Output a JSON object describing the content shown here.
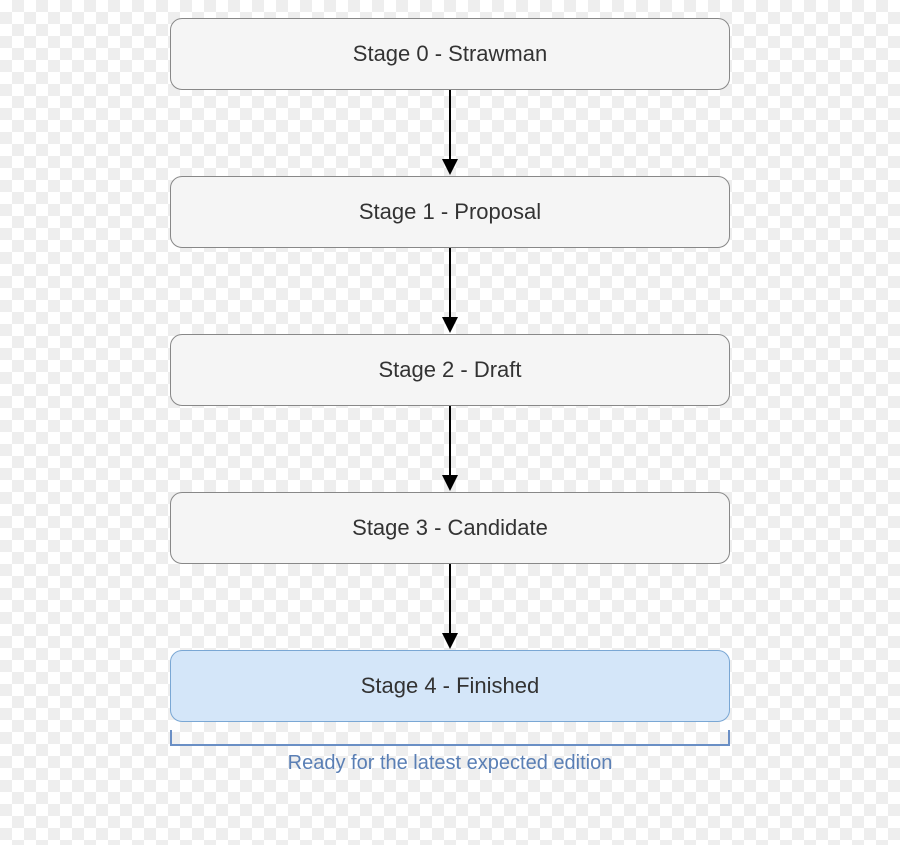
{
  "stages": {
    "s0": "Stage 0 - Strawman",
    "s1": "Stage 1 - Proposal",
    "s2": "Stage 2 - Draft",
    "s3": "Stage 3 - Candidate",
    "s4": "Stage 4 - Finished"
  },
  "bracket_label": "Ready for the latest expected edition"
}
